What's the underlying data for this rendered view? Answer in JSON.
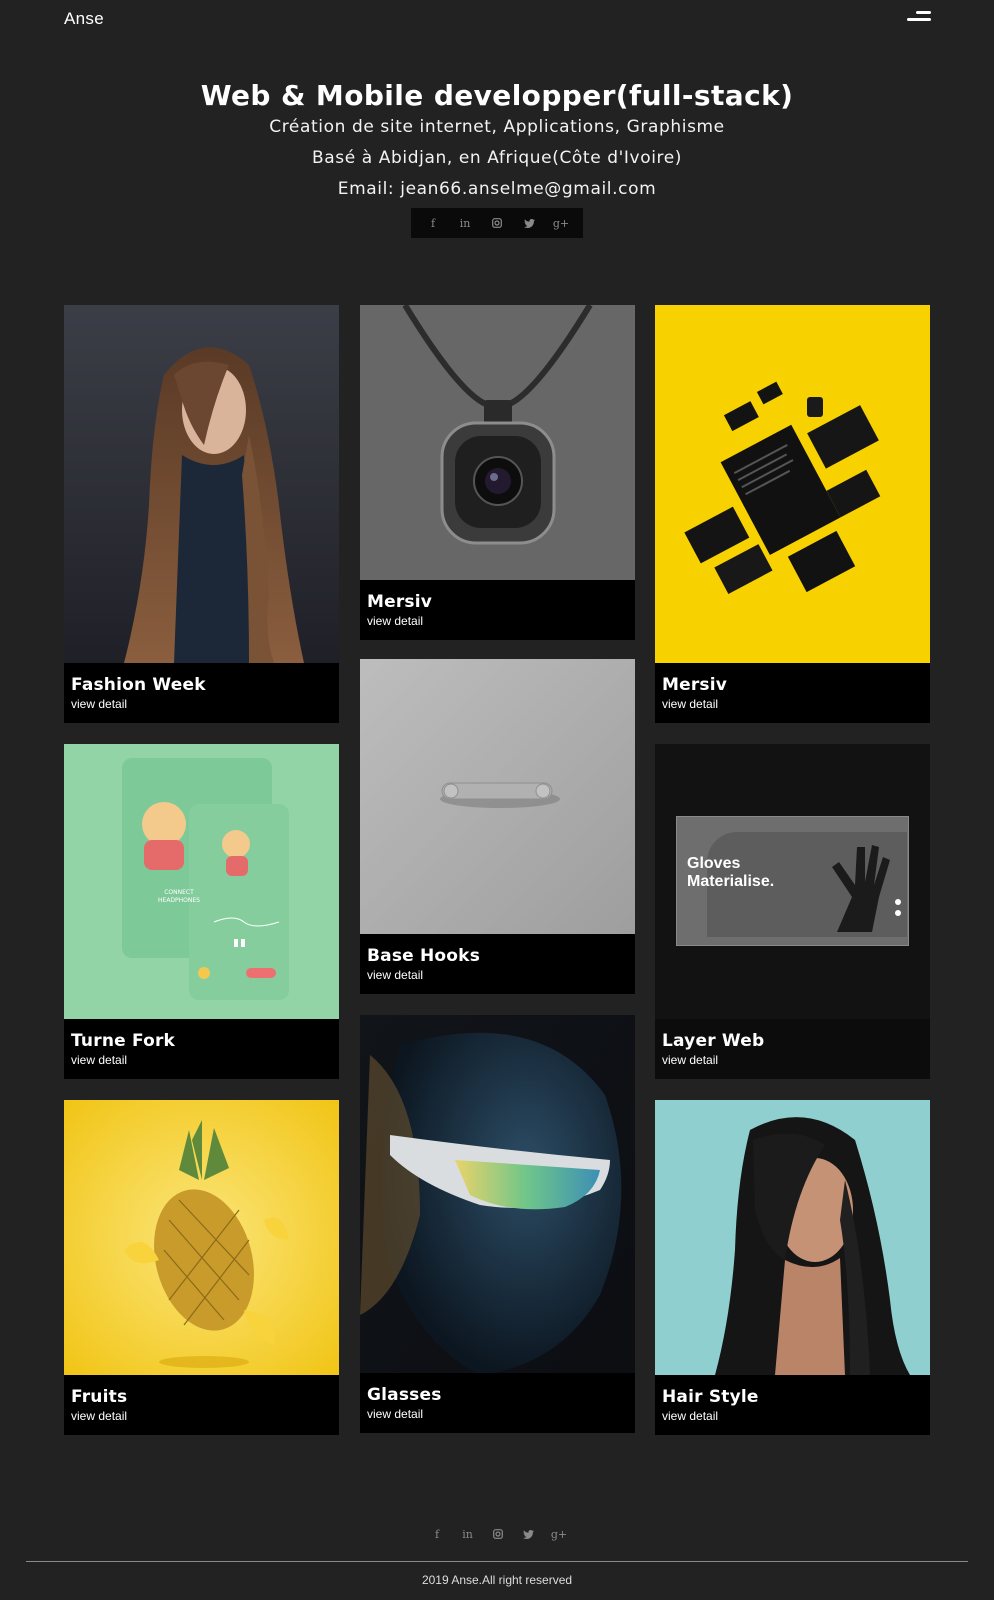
{
  "header": {
    "logo": "Anse",
    "menu_icon": "hamburger-icon"
  },
  "hero": {
    "title": "Web & Mobile developper(full-stack)",
    "line1": "Création de site internet, Applications, Graphisme",
    "line2": "Basé à Abidjan, en Afrique(Côte d'Ivoire)",
    "line3": "Email: jean66.anselme@gmail.com"
  },
  "social": {
    "facebook": "f",
    "linkedin": "in",
    "instagram": "instagram-icon",
    "twitter": "twitter-icon",
    "googleplus": "g+"
  },
  "portfolio": {
    "items": [
      {
        "title": "Fashion Week",
        "link": "view detail"
      },
      {
        "title": "Mersiv",
        "link": "view detail"
      },
      {
        "title": "Mersiv",
        "link": "view detail"
      },
      {
        "title": "Turne Fork",
        "link": "view detail"
      },
      {
        "title": "Base Hooks",
        "link": "view detail"
      },
      {
        "title": "Layer Web",
        "link": "view detail"
      },
      {
        "title": "Fruits",
        "link": "view detail"
      },
      {
        "title": "Glasses",
        "link": "view detail"
      },
      {
        "title": "Hair Style",
        "link": "view detail"
      }
    ],
    "layer_web_mock": {
      "line1": "Gloves",
      "line2": "Materialise."
    }
  },
  "footer": {
    "copyright": "2019 Anse.All right reserved"
  },
  "colors": {
    "background": "#222223",
    "card": "#000000",
    "yellow": "#f8d200",
    "mint": "#92d4a6"
  }
}
